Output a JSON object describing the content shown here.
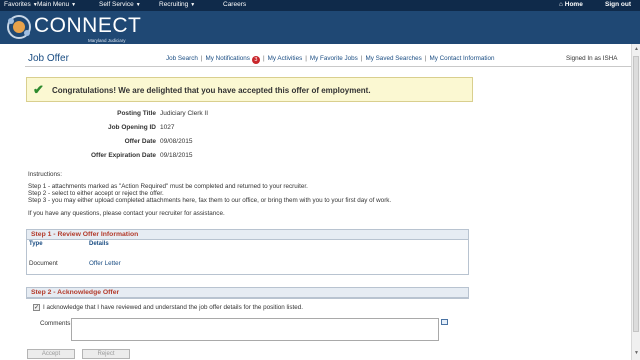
{
  "topnav": {
    "favorites": "Favorites",
    "main_menu": "Main Menu",
    "self_service": "Self Service",
    "recruiting": "Recruiting",
    "careers": "Careers",
    "home": "Home",
    "sign_out": "Sign out"
  },
  "brand": {
    "name": "CONNECT",
    "subtitle": "Maryland Judiciary"
  },
  "page": {
    "title": "Job Offer",
    "signed_in": "Signed In as ISHA"
  },
  "links": {
    "job_search": "Job Search",
    "my_notifications": "My Notifications",
    "notification_count": "3",
    "my_activities": "My Activities",
    "my_favorite_jobs": "My Favorite Jobs",
    "my_saved_searches": "My Saved Searches",
    "my_contact_information": "My Contact Information"
  },
  "congrats": {
    "message": "Congratulations! We are delighted that you have accepted this offer of employment."
  },
  "offer": {
    "posting_title_label": "Posting Title",
    "posting_title": "Judiciary Clerk II",
    "job_opening_id_label": "Job Opening ID",
    "job_opening_id": "1027",
    "offer_date_label": "Offer Date",
    "offer_date": "09/08/2015",
    "offer_expiration_label": "Offer Expiration Date",
    "offer_expiration": "09/18/2015"
  },
  "instructions": {
    "heading": "Instructions:",
    "step1": "Step 1 - attachments marked as \"Action Required\" must be completed and returned to your recruiter.",
    "step2": "Step 2 - select to either accept or reject the offer.",
    "step3": "Step 3 - you may either upload completed attachments here, fax them to our office, or bring them with you to your first day of work.",
    "questions": "If you have any questions, please contact your recruiter for assistance."
  },
  "step1": {
    "title": "Step 1 - Review Offer Information",
    "col_type": "Type",
    "col_details": "Details",
    "rows": [
      {
        "type": "Document",
        "details": "Offer Letter"
      }
    ]
  },
  "step2": {
    "title": "Step 2 - Acknowledge Offer",
    "ack_text": "I acknowledge that I have reviewed and understand the job offer details for the position listed.",
    "comments_label": "Comments"
  },
  "buttons": {
    "accept": "Accept",
    "reject": "Reject"
  },
  "colors": {
    "topbar": "#0f2a4a",
    "header": "#1f4874",
    "link": "#1a4d83",
    "section_title": "#b33a2a"
  }
}
